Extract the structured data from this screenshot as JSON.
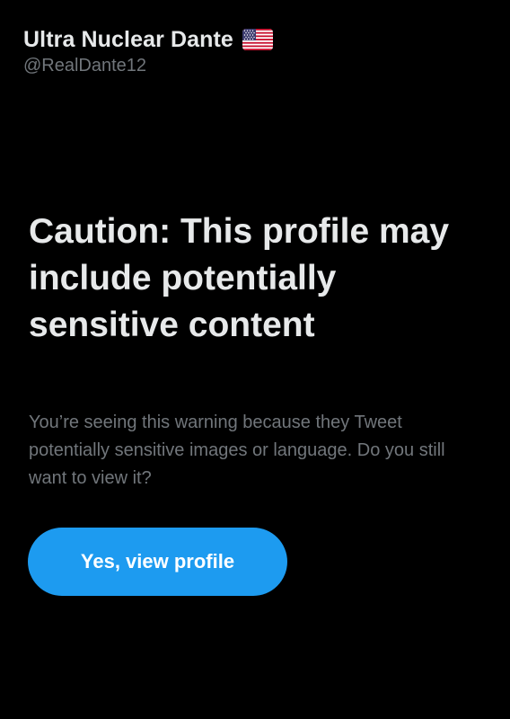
{
  "profile": {
    "display_name": "Ultra Nuclear Dante",
    "flag_icon": "us-flag-icon",
    "handle": "@RealDante12"
  },
  "warning": {
    "title": "Caution: This profile may include potentially sensitive content",
    "body": "You’re seeing this warning because they Tweet potentially sensitive images or language. Do you still want to view it?"
  },
  "actions": {
    "view_profile_label": "Yes, view profile"
  },
  "colors": {
    "background": "#000000",
    "primary_text": "#e7e9ea",
    "secondary_text": "#71767b",
    "accent": "#1d9bf0",
    "button_text": "#ffffff"
  }
}
